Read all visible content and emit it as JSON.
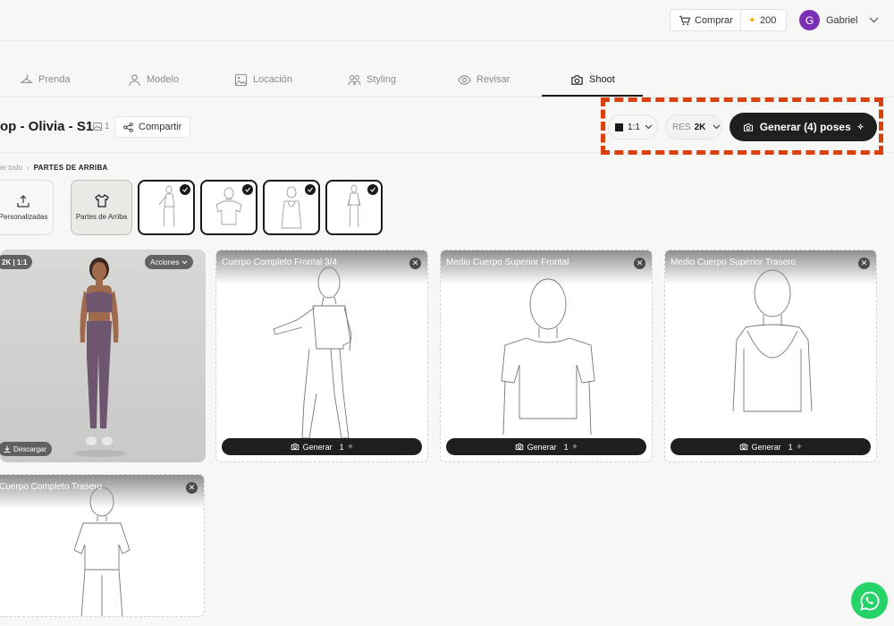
{
  "header": {
    "buy_label": "Comprar",
    "credits": "200",
    "user_initial": "G",
    "user_name": "Gabriel"
  },
  "tabs": [
    {
      "label": "Prenda",
      "icon": "hanger-icon"
    },
    {
      "label": "Modelo",
      "icon": "user-icon"
    },
    {
      "label": "Locación",
      "icon": "image-icon"
    },
    {
      "label": "Styling",
      "icon": "users-icon"
    },
    {
      "label": "Revisar",
      "icon": "eye-icon"
    },
    {
      "label": "Shoot",
      "icon": "camera-icon",
      "active": true
    }
  ],
  "project": {
    "title": "op - Olivia - S1",
    "image_count": "1",
    "share_label": "Compartir"
  },
  "controls": {
    "ratio": "1:1",
    "res_prefix": "RES",
    "res_value": "2K",
    "generate_label": "Generar (4) poses",
    "highlight_color": "#d9410f"
  },
  "breadcrumb": {
    "parent": "er todo",
    "separator": "›",
    "current": "PARTES DE ARRIBA"
  },
  "categories": [
    {
      "label": "Personalizadas",
      "icon": "upload-icon"
    },
    {
      "label": "Partes de Arriba",
      "icon": "shirt-icon",
      "selected": true
    }
  ],
  "photo_card": {
    "badge": "2K | 1:1",
    "actions_label": "Acciones",
    "download_label": "Descargar"
  },
  "pose_cards": [
    {
      "title": "Cuerpo Completo Frontal 3/4",
      "generate_label": "Generar",
      "count": "1"
    },
    {
      "title": "Medio Cuerpo Superior Frontal",
      "generate_label": "Generar",
      "count": "1"
    },
    {
      "title": "Medio Cuerpo Superior Trasero",
      "generate_label": "Generar",
      "count": "1"
    },
    {
      "title": "Cuerpo Completo Trasero"
    }
  ],
  "colors": {
    "accent_dark": "#1f1f1f",
    "avatar": "#7b2fb5",
    "whatsapp": "#25d366"
  }
}
